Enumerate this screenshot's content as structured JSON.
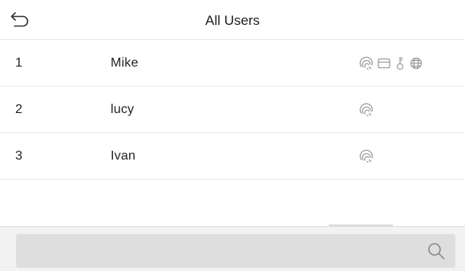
{
  "header": {
    "title": "All Users"
  },
  "users": [
    {
      "number": "1",
      "name": "Mike",
      "icons": [
        "fingerprint-icon",
        "card-icon",
        "key-icon",
        "face-icon"
      ]
    },
    {
      "number": "2",
      "name": "lucy",
      "icons": [
        "fingerprint-icon"
      ]
    },
    {
      "number": "3",
      "name": "Ivan",
      "icons": [
        "fingerprint-icon"
      ]
    }
  ],
  "search": {
    "value": ""
  },
  "colors": {
    "icon_gray": "#9e9e9e",
    "divider": "#e8e8e8",
    "bottom_bar": "#f2f2f2",
    "search_fill": "#dedede"
  }
}
